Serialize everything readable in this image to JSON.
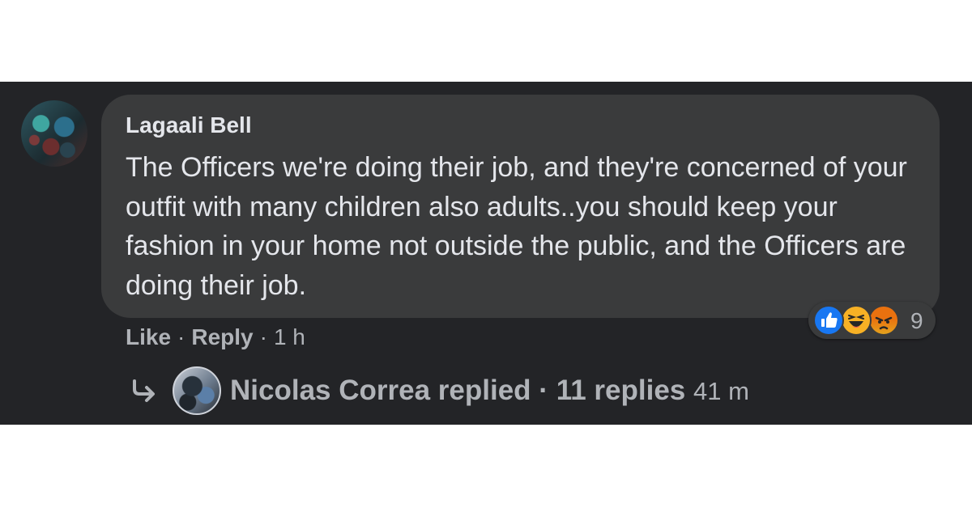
{
  "comment": {
    "author": "Lagaali Bell",
    "text": "The Officers we're doing their job, and they're concerned of your outfit with many children also adults..you should keep your fashion in your home not outside the public, and the Officers are doing their job.",
    "reactions": {
      "icons": [
        "like-icon",
        "haha-icon",
        "angry-icon"
      ],
      "count": "9"
    },
    "actions": {
      "like_label": "Like",
      "reply_label": "Reply",
      "separator": "·",
      "time": "1 h"
    }
  },
  "reply_summary": {
    "name": "Nicolas Correa",
    "verb": "replied",
    "separator": "·",
    "replies_label": "11 replies",
    "time": "41 m"
  },
  "colors": {
    "background": "#232427",
    "bubble": "#3a3b3c",
    "primary_text": "#e4e6eb",
    "secondary_text": "#b0b3b8",
    "like_blue": "#1877f2"
  }
}
